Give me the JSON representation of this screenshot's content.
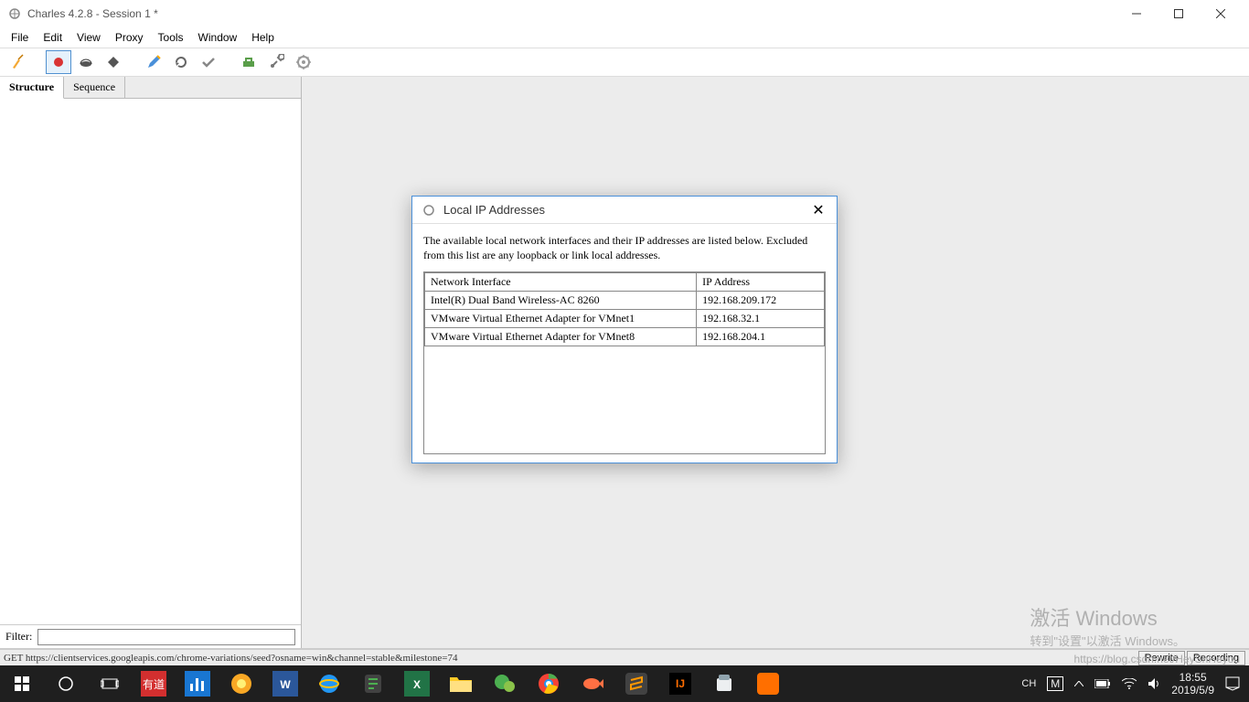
{
  "window": {
    "title": "Charles 4.2.8 - Session 1 *"
  },
  "menu": [
    "File",
    "Edit",
    "View",
    "Proxy",
    "Tools",
    "Window",
    "Help"
  ],
  "tabs": {
    "structure": "Structure",
    "sequence": "Sequence"
  },
  "filter": {
    "label": "Filter:",
    "value": ""
  },
  "dialog": {
    "title": "Local IP Addresses",
    "desc": "The available local network interfaces and their IP addresses are listed below.  Excluded from this list are any loopback or link local addresses.",
    "col1": "Network Interface",
    "col2": "IP Address",
    "rows": [
      {
        "iface": "Intel(R) Dual Band Wireless-AC 8260",
        "ip": "192.168.209.172"
      },
      {
        "iface": "VMware Virtual Ethernet Adapter for VMnet1",
        "ip": "192.168.32.1"
      },
      {
        "iface": "VMware Virtual Ethernet Adapter for VMnet8",
        "ip": "192.168.204.1"
      }
    ]
  },
  "status": {
    "text": "GET https://clientservices.googleapis.com/chrome-variations/seed?osname=win&channel=stable&milestone=74",
    "btn1": "Rewrite",
    "btn2": "Recording"
  },
  "watermark": {
    "line1": "激活 Windows",
    "line2": "转到\"设置\"以激活 Windows。"
  },
  "url_wm": "https://blog.csdn.net/HeyShHeyou",
  "tray": {
    "lang": "CH",
    "ime": "M",
    "time": "18:55",
    "date": "2019/5/9"
  }
}
